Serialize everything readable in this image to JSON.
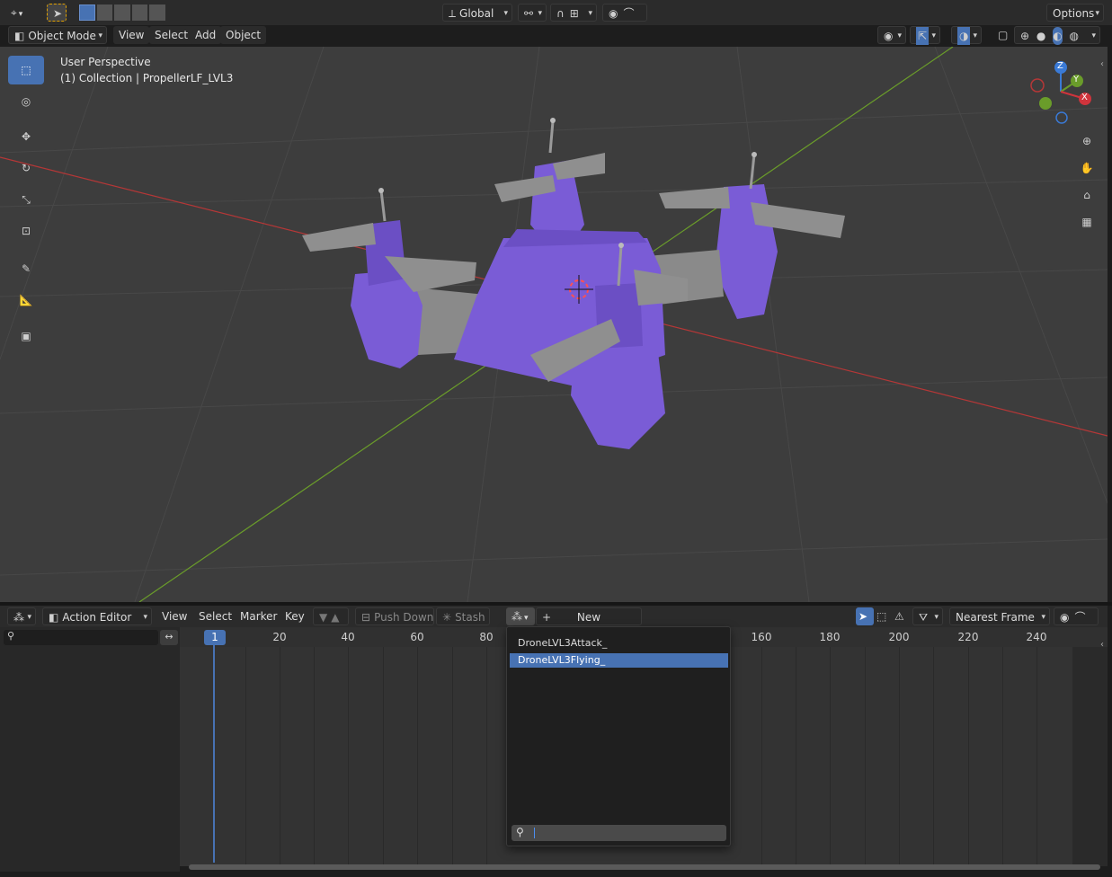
{
  "viewport_header": {
    "mode": "Object Mode",
    "menus": [
      "View",
      "Select",
      "Add",
      "Object"
    ],
    "transform_orientation": "Global",
    "options_label": "Options"
  },
  "viewport": {
    "perspective_label": "User Perspective",
    "collection_label": "(1) Collection | PropellerLF_LVL3",
    "gizmo": {
      "x": "X",
      "y": "Y",
      "z": "Z"
    },
    "colors": {
      "bg": "#3d3d3d",
      "x_axis": "#b53737",
      "y_axis": "#6a9c2a",
      "drone": "#7a5cd6",
      "propeller": "#8f8f8f"
    }
  },
  "tools": [
    "select-box",
    "cursor",
    "move",
    "rotate",
    "scale",
    "transform",
    "annotate",
    "measure",
    "add-cube"
  ],
  "action_editor_header": {
    "editor_mode": "Action Editor",
    "menus": [
      "View",
      "Select",
      "Marker",
      "Key"
    ],
    "push_down": "Push Down",
    "stash": "Stash",
    "new_label": "New",
    "snap_mode": "Nearest Frame"
  },
  "timeline": {
    "current_frame": "1",
    "ticks": [
      "20",
      "40",
      "60",
      "80",
      "160",
      "180",
      "200",
      "220",
      "240"
    ]
  },
  "action_dropdown": {
    "items": [
      {
        "label": "DroneLVL3Attack_",
        "selected": false
      },
      {
        "label": "DroneLVL3Flying_",
        "selected": true
      }
    ],
    "search_placeholder": ""
  }
}
